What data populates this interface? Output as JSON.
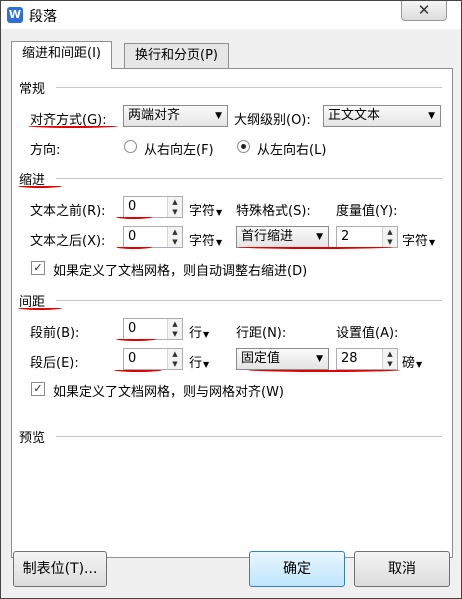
{
  "window": {
    "title": "段落",
    "app_icon": "W",
    "close_glyph": "✕"
  },
  "tabs": [
    {
      "label": "缩进和间距(I)"
    },
    {
      "label": "换行和分页(P)"
    }
  ],
  "general": {
    "section_title": "常规",
    "alignment_label": "对齐方式(G):",
    "alignment_value": "两端对齐",
    "outline_label": "大纲级别(O):",
    "outline_value": "正文文本",
    "direction_label": "方向:",
    "rtl_label": "从右向左(F)",
    "ltr_label": "从左向右(L)",
    "selected_direction": "ltr"
  },
  "indent": {
    "section_title": "缩进",
    "before_label": "文本之前(R):",
    "before_value": "0",
    "before_unit": "字符",
    "after_label": "文本之后(X):",
    "after_value": "0",
    "after_unit": "字符",
    "special_label": "特殊格式(S):",
    "special_value": "首行缩进",
    "measure_label": "度量值(Y):",
    "measure_value": "2",
    "measure_unit": "字符",
    "auto_adjust_label": "如果定义了文档网格，则自动调整右缩进(D)",
    "auto_adjust_checked": true
  },
  "spacing": {
    "section_title": "间距",
    "before_label": "段前(B):",
    "before_value": "0",
    "before_unit": "行",
    "after_label": "段后(E):",
    "after_value": "0",
    "after_unit": "行",
    "line_spacing_label": "行距(N):",
    "line_spacing_value": "固定值",
    "setting_label": "设置值(A):",
    "setting_value": "28",
    "setting_unit": "磅",
    "snap_grid_label": "如果定义了文档网格，则与网格对齐(W)",
    "snap_grid_checked": true
  },
  "preview": {
    "section_title": "预览"
  },
  "buttons": {
    "tabs_label": "制表位(T)...",
    "ok_label": "确定",
    "cancel_label": "取消"
  },
  "annotation_color": "#e00000"
}
